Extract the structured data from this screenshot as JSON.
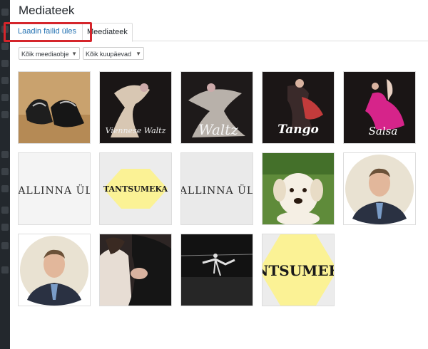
{
  "page": {
    "title": "Mediateek",
    "tabs": [
      {
        "label": "Laadin failid üles"
      },
      {
        "label": "Meediateek"
      }
    ]
  },
  "filters": {
    "type": "Kõik meediaobje",
    "date": "Kõik kuupäevad"
  },
  "media": {
    "items": [
      {
        "kind": "shoes"
      },
      {
        "kind": "dancers",
        "caption": "Viennese Waltz"
      },
      {
        "kind": "dancers",
        "caption": "Waltz"
      },
      {
        "kind": "dancers",
        "caption": "Tango"
      },
      {
        "kind": "dancers",
        "caption": "Salsa"
      },
      {
        "kind": "text-banner",
        "text": "TALLINNA ÜLI"
      },
      {
        "kind": "logo",
        "text": "TANTSUMEKA"
      },
      {
        "kind": "text-banner",
        "text": "ALLINNA ÜL"
      },
      {
        "kind": "puppy"
      },
      {
        "kind": "portrait"
      },
      {
        "kind": "portrait"
      },
      {
        "kind": "couple"
      },
      {
        "kind": "stage"
      },
      {
        "kind": "logo",
        "text": "NTSUMEK"
      }
    ]
  },
  "colors": {
    "highlight": "#d5252b",
    "link": "#2271b1",
    "logo_yellow": "#fbf295",
    "sidebar": "#23282d"
  }
}
